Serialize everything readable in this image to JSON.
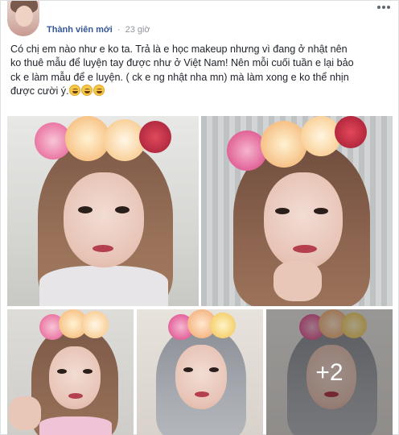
{
  "post": {
    "author_name": "Thành viên mới",
    "separator": "·",
    "time": "23 giờ",
    "text_lines": [
      "Có chị em nào như e ko ta. Trả là e học makeup nhưng vì đang ở nhật nên",
      "ko thuê mẫu để luyện tay được như ở Việt Nam! Nên mỗi cuối tuần e lại bảo",
      "ck e làm mẫu để e luyện. ( ck e ng nhật nha mn) mà làm xong e ko thể nhịn",
      "được cười ý."
    ],
    "emoji_names": [
      "grinning-face-icon",
      "grinning-face-icon",
      "grinning-face-icon"
    ]
  },
  "photos": {
    "count": 5,
    "more_overlay": "+2",
    "subjects": [
      "man with makeup and flower crown, long brown wig",
      "man with makeup and flower crown, smiling",
      "man with flower crown making heart gesture",
      "man with flower crown, grey wig",
      "man with flower crown, grey wig"
    ]
  },
  "colors": {
    "name_link": "#365899",
    "meta_gray": "#90949c",
    "text": "#1d2129"
  }
}
